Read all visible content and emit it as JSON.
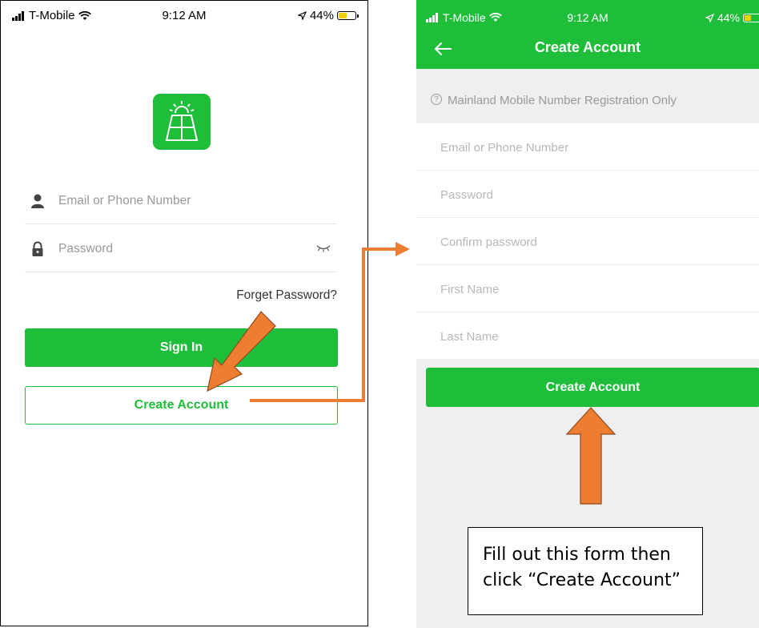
{
  "colors": {
    "brand_green": "#1fbe3a",
    "arrow_orange": "#ed7d31",
    "placeholder_gray": "#999999"
  },
  "left_screen": {
    "status": {
      "carrier": "T-Mobile",
      "time": "9:12 AM",
      "battery": "44%",
      "battery_level": 0.44
    },
    "logo_icon": "solar-panel-icon",
    "email_field": {
      "placeholder": "Email or Phone Number",
      "icon": "person-icon"
    },
    "password_field": {
      "placeholder": "Password",
      "icon": "lock-icon",
      "toggle_icon": "eye-closed-icon"
    },
    "forget_password": "Forget Password?",
    "sign_in_button": "Sign In",
    "create_account_button": "Create Account"
  },
  "right_screen": {
    "status": {
      "carrier": "T-Mobile",
      "time": "9:12 AM",
      "battery": "44%",
      "battery_level": 0.44
    },
    "nav": {
      "title": "Create Account",
      "back_icon": "back-arrow-icon"
    },
    "notice": "Mainland Mobile Number Registration Only",
    "fields": [
      {
        "placeholder": "Email or Phone Number"
      },
      {
        "placeholder": "Password"
      },
      {
        "placeholder": "Confirm password"
      },
      {
        "placeholder": "First Name"
      },
      {
        "placeholder": "Last Name"
      }
    ],
    "create_account_button": "Create Account"
  },
  "annotation": {
    "callout_line1": "Fill out this form then",
    "callout_line2": "click “Create Account”"
  }
}
